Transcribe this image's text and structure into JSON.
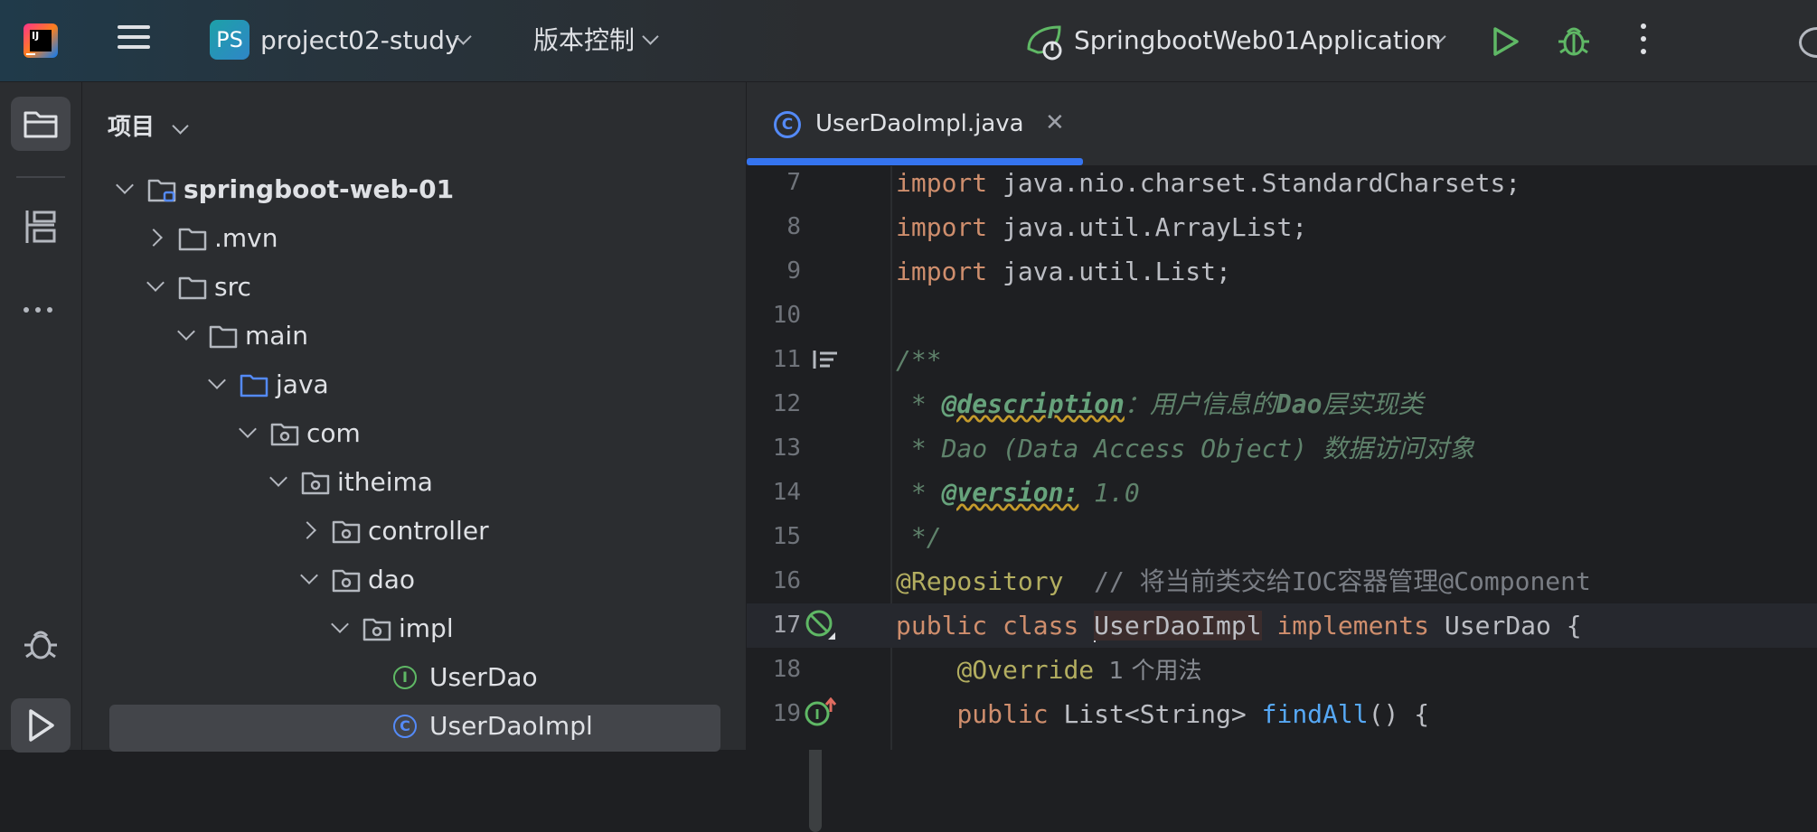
{
  "titlebar": {
    "project_badge": "PS",
    "project_name": "project02-study",
    "vcs_label": "版本控制",
    "run_config": "SpringbootWeb01Application"
  },
  "icons": [
    "app-logo-icon",
    "hamburger-menu-icon",
    "chevron-down-icon",
    "spring-boot-run-config-icon",
    "run-icon",
    "debug-bug-icon",
    "more-vertical-icon",
    "folder-icon",
    "structure-icon",
    "more-horizontal-icon",
    "play-icon",
    "class-icon",
    "interface-icon",
    "close-icon",
    "no-bean-gutter-icon",
    "implemented-method-gutter-icon",
    "doc-render-icon"
  ],
  "sidebar": {
    "panel_title": "项目"
  },
  "tree": [
    {
      "label": "springboot-web-01",
      "depth": 0,
      "expanded": true,
      "icon": "module-folder-icon",
      "bold": true
    },
    {
      "label": ".mvn",
      "depth": 1,
      "expanded": false,
      "icon": "folder-icon"
    },
    {
      "label": "src",
      "depth": 1,
      "expanded": true,
      "icon": "folder-icon"
    },
    {
      "label": "main",
      "depth": 2,
      "expanded": true,
      "icon": "folder-icon"
    },
    {
      "label": "java",
      "depth": 3,
      "expanded": true,
      "icon": "source-folder-icon"
    },
    {
      "label": "com",
      "depth": 4,
      "expanded": true,
      "icon": "package-icon"
    },
    {
      "label": "itheima",
      "depth": 5,
      "expanded": true,
      "icon": "package-icon"
    },
    {
      "label": "controller",
      "depth": 6,
      "expanded": false,
      "icon": "package-icon"
    },
    {
      "label": "dao",
      "depth": 6,
      "expanded": true,
      "icon": "package-icon"
    },
    {
      "label": "impl",
      "depth": 7,
      "expanded": true,
      "icon": "package-icon"
    },
    {
      "label": "UserDao",
      "depth": 8,
      "icon": "interface-icon"
    },
    {
      "label": "UserDaoImpl",
      "depth": 8,
      "icon": "class-icon",
      "selected": true
    }
  ],
  "editor": {
    "tab_title": "UserDaoImpl.java",
    "lines": [
      {
        "num": "7",
        "tokens": [
          [
            "kw",
            "import"
          ],
          [
            "",
            "java.nio.charset.StandardCharsets;"
          ]
        ]
      },
      {
        "num": "8",
        "tokens": [
          [
            "kw",
            "import"
          ],
          [
            "",
            "java.util.ArrayList;"
          ]
        ]
      },
      {
        "num": "9",
        "tokens": [
          [
            "kw",
            "import"
          ],
          [
            "",
            "java.util.List;"
          ]
        ]
      },
      {
        "num": "10",
        "tokens": []
      },
      {
        "num": "11",
        "tokens": [
          [
            "doc",
            "/**"
          ]
        ]
      },
      {
        "num": "12",
        "tokens": [
          [
            "doc",
            " * "
          ],
          [
            "doctag",
            "@description"
          ],
          [
            "doc",
            "：用户信息的"
          ],
          [
            "doc-bold",
            "Dao"
          ],
          [
            "doc",
            "层实现类"
          ]
        ]
      },
      {
        "num": "13",
        "tokens": [
          [
            "doc",
            " * Dao (Data Access Object) 数据访问对象"
          ]
        ]
      },
      {
        "num": "14",
        "tokens": [
          [
            "doc",
            " * "
          ],
          [
            "doctag",
            "@version:"
          ],
          [
            "doc",
            " 1.0"
          ]
        ]
      },
      {
        "num": "15",
        "tokens": [
          [
            "doc",
            " */"
          ]
        ]
      },
      {
        "num": "16",
        "tokens": [
          [
            "ann",
            "@Repository"
          ],
          [
            "cmt",
            "  // 将当前类交给IOC容器管理@Component"
          ]
        ]
      },
      {
        "num": "17",
        "tokens": [
          [
            "kw",
            "public class"
          ],
          [
            "",
            "CARET"
          ],
          [
            "cls-hl",
            "UserDaoImpl"
          ],
          [
            "kw",
            " implements"
          ],
          [
            "",
            " UserDao {"
          ]
        ],
        "current": true
      },
      {
        "num": "18",
        "tokens": [
          [
            "",
            "    "
          ],
          [
            "ann",
            "@Override"
          ],
          [
            "hint",
            "  1 个用法"
          ]
        ]
      },
      {
        "num": "19",
        "tokens": [
          [
            "",
            "    "
          ],
          [
            "kw",
            "public"
          ],
          [
            "",
            " List<String> "
          ],
          [
            "fn",
            "findAll"
          ],
          [
            "",
            "() {"
          ]
        ]
      }
    ]
  },
  "colors": {
    "accent": "#3574f0",
    "keyword": "#cf8e6d",
    "annotation": "#b3ae60",
    "doc_comment": "#5f826b",
    "function": "#56a8f5",
    "run_green": "#5fb865"
  }
}
